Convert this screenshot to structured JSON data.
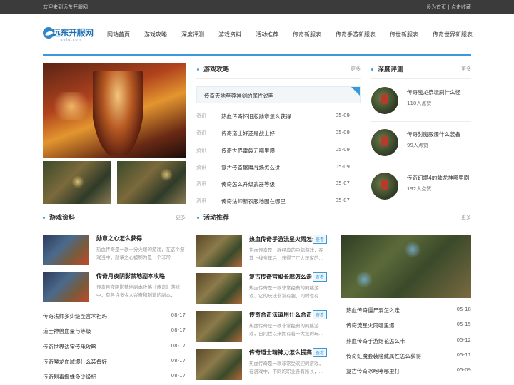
{
  "topbar": {
    "welcome": "欢迎来到远东开服网",
    "links": "设为首页 | 点击收藏"
  },
  "logo": {
    "name": "远东开服网",
    "domain": "luelu.com"
  },
  "nav": [
    "网站首页",
    "游戏攻略",
    "深度评测",
    "游戏资料",
    "活动推荐",
    "传奇新服表",
    "传奇手游新服表",
    "传世新服表",
    "传奇世界新服表"
  ],
  "guide": {
    "title": "游戏攻略",
    "more": "更多",
    "notice": "传奇天地至尊神剑的属性说明",
    "rows": [
      {
        "tag": "资讯",
        "title": "热血传奇怀旧版勋章怎么获得",
        "date": "05-09"
      },
      {
        "tag": "资讯",
        "title": "传奇道士好还是战士好",
        "date": "05-09"
      },
      {
        "tag": "资讯",
        "title": "传奇世界雷裂刀哪里爆",
        "date": "05-09"
      },
      {
        "tag": "资讯",
        "title": "复古传奇屠魔战场怎么进",
        "date": "05-09"
      },
      {
        "tag": "资讯",
        "title": "传奇怎么升级武器等级",
        "date": "05-07"
      },
      {
        "tag": "资讯",
        "title": "传奇法师新农服地图在哪里",
        "date": "05-07"
      }
    ]
  },
  "review": {
    "title": "深度评测",
    "more": "更多",
    "items": [
      {
        "title": "传奇魔龙祭坛刷什么怪",
        "count": "110人点赞"
      },
      {
        "title": "传奇封魔殿爆什么装备",
        "count": "99人点赞"
      },
      {
        "title": "传奇幻境4的触龙神哪里刷",
        "count": "192人点赞"
      }
    ]
  },
  "data_section": {
    "title": "游戏资料",
    "more": "更多",
    "articles": [
      {
        "title": "勋章之心怎么获得",
        "desc": "热血传奇是一款十分火爆的游戏，在这个游戏当中，勋章之心被称为是一个非常"
      },
      {
        "title": "传奇月夜阴影禁地副本攻略",
        "desc": "传奇月夜阴影禁地副本攻略《传奇》游戏中，有各许多令人兴奋和刺激的副本，"
      }
    ],
    "rows": [
      {
        "title": "传奇法师多少级圣言术祖玛",
        "date": "08-17"
      },
      {
        "title": "道士神兽血量与等级",
        "date": "08-17"
      },
      {
        "title": "传奇世界法宝传承攻略",
        "date": "08-17"
      },
      {
        "title": "传奇魔龙血域爆什么装备好",
        "date": "08-17"
      },
      {
        "title": "传奇剧毒蜘蛛多少级招",
        "date": "08-17"
      }
    ]
  },
  "activity": {
    "title": "活动推荐",
    "more": "更多",
    "badge": "查看",
    "items": [
      {
        "title": "热血传奇手游流星火雨怎么获得",
        "desc": "热血传奇是一款经典的电脑游戏，在其上线多年后，获得了广大玩家的…"
      },
      {
        "title": "复古传奇宫殿长廊怎么走",
        "desc": "热血传奇是一款非常经典的网络游戏，它的玩法非常有趣，同时也有…"
      },
      {
        "title": "传奇合击法道用什么合击",
        "desc": "热血传奇是一款非常经典的网络游戏，自问世以来拥有着一大批的玩…"
      },
      {
        "title": "传奇道士精神力怎么提高",
        "desc": "热血传奇是一款非常受欢迎的游戏，在游戏中，不同的职业各有所长，…"
      }
    ],
    "rows": [
      {
        "title": "热血传奇僵尸洞怎么走",
        "date": "05-18"
      },
      {
        "title": "传奇流星火雨哪里爆",
        "date": "05-15"
      },
      {
        "title": "热血传奇手游烟花怎么卡",
        "date": "05-12"
      },
      {
        "title": "传奇虹魔套装隐藏属性怎么获得",
        "date": "05-11"
      },
      {
        "title": "复古传奇冰咆哮哪里打",
        "date": "05-09"
      }
    ]
  }
}
